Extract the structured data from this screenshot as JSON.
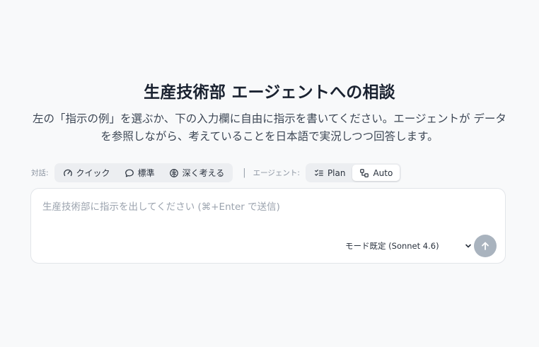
{
  "header": {
    "title": "生産技術部 エージェントへの相談",
    "subtitle": "左の「指示の例」を選ぶか、下の入力欄に自由に指示を書いてください。エージェントが データを参照しながら、考えていることを日本語で実況しつつ回答します。"
  },
  "toolbar": {
    "dialog_label": "対話:",
    "modes": [
      {
        "label": "クイック",
        "icon": "gauge-icon"
      },
      {
        "label": "標準",
        "icon": "chat-bubble-icon"
      },
      {
        "label": "深く考える",
        "icon": "brain-icon"
      }
    ],
    "separator": "|",
    "agent_label": "エージェント:",
    "agent_modes": [
      {
        "label": "Plan",
        "icon": "checklist-icon",
        "active": false
      },
      {
        "label": "Auto",
        "icon": "workflow-icon",
        "active": true
      }
    ]
  },
  "input": {
    "placeholder": "生産技術部に指示を出してください (⌘+Enter で送信)",
    "value": "",
    "model": "モード既定 (Sonnet 4.6)"
  },
  "colors": {
    "background": "#f8f9fa",
    "send_button": "#a9b3be"
  }
}
